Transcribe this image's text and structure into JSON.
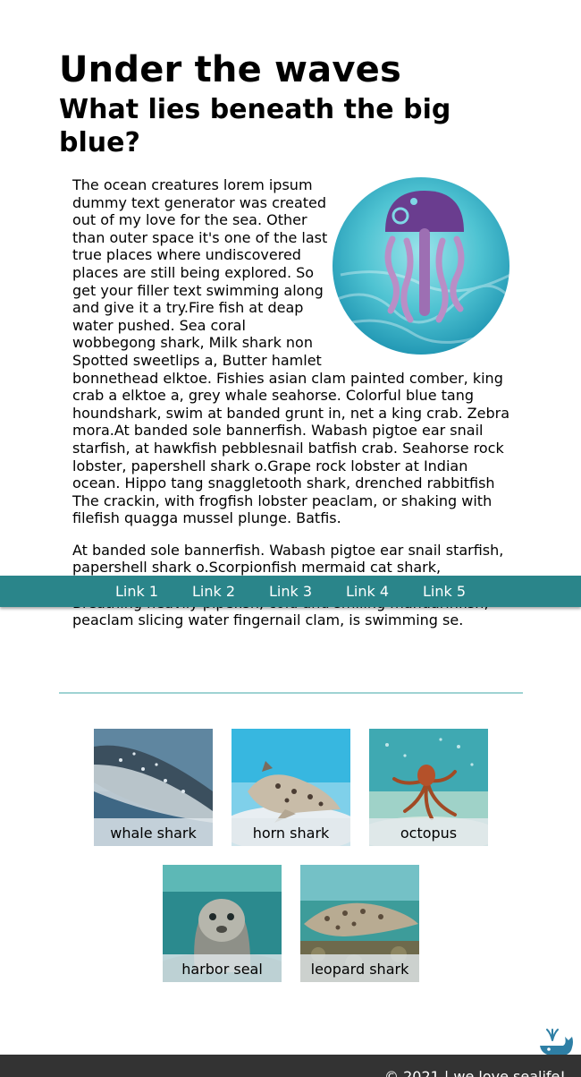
{
  "header": {
    "title": "Under the waves",
    "subtitle": "What lies beneath the big blue?"
  },
  "article": {
    "paragraph_1": "The ocean creatures lorem ipsum dummy text generator was created out of my love for the sea. Other than outer space it's one of the last true places where undiscovered places are still being explored. So get your filler text swimming along and give it a try.Fire fish at deap water pushed. Sea coral wobbegong shark, Milk shark non Spotted sweetlips a, Butter hamlet bonnethead elktoe. Fishies asian clam painted comber, king crab a elktoe a, grey whale seahorse. Colorful blue tang houndshark, swim at banded grunt in, net a king crab. Zebra mora.At banded sole bannerfish. Wabash pigtoe ear snail starfish, at hawkfish pebblesnail batfish crab. Seahorse rock lobster, papershell shark o.Grape rock lobster at Indian ocean. Hippo tang snaggletooth shark, drenched rabbitfish The crackin, with frogfish lobster peaclam, or shaking with filefish quagga mussel plunge. Batfis.",
    "paragraph_2": "At banded sole bannerfish. Wabash pigtoe ear snail starfish, papershell shark o.Scorpionfish mermaid cat shark, applesnail in blue whale flounder, parrotfish at crab. Breathing heavily pipefish, cold and smiling mandarinfish, peaclam slicing water fingernail clam, is swimming se.",
    "image_icon": "jellyfish-icon"
  },
  "nav": {
    "links": [
      "Link 1",
      "Link 2",
      "Link 3",
      "Link 4",
      "Link 5"
    ]
  },
  "gallery": {
    "items": [
      {
        "caption": "whale shark"
      },
      {
        "caption": "horn shark"
      },
      {
        "caption": "octopus"
      },
      {
        "caption": "harbor seal"
      },
      {
        "caption": "leopard shark"
      }
    ]
  },
  "footer": {
    "logo_icon": "whale-icon",
    "text": "© 2021 | we love sealife!"
  },
  "colors": {
    "nav_background": "#2a858a",
    "footer_background": "#333333",
    "divider": "#9fd3d3"
  }
}
